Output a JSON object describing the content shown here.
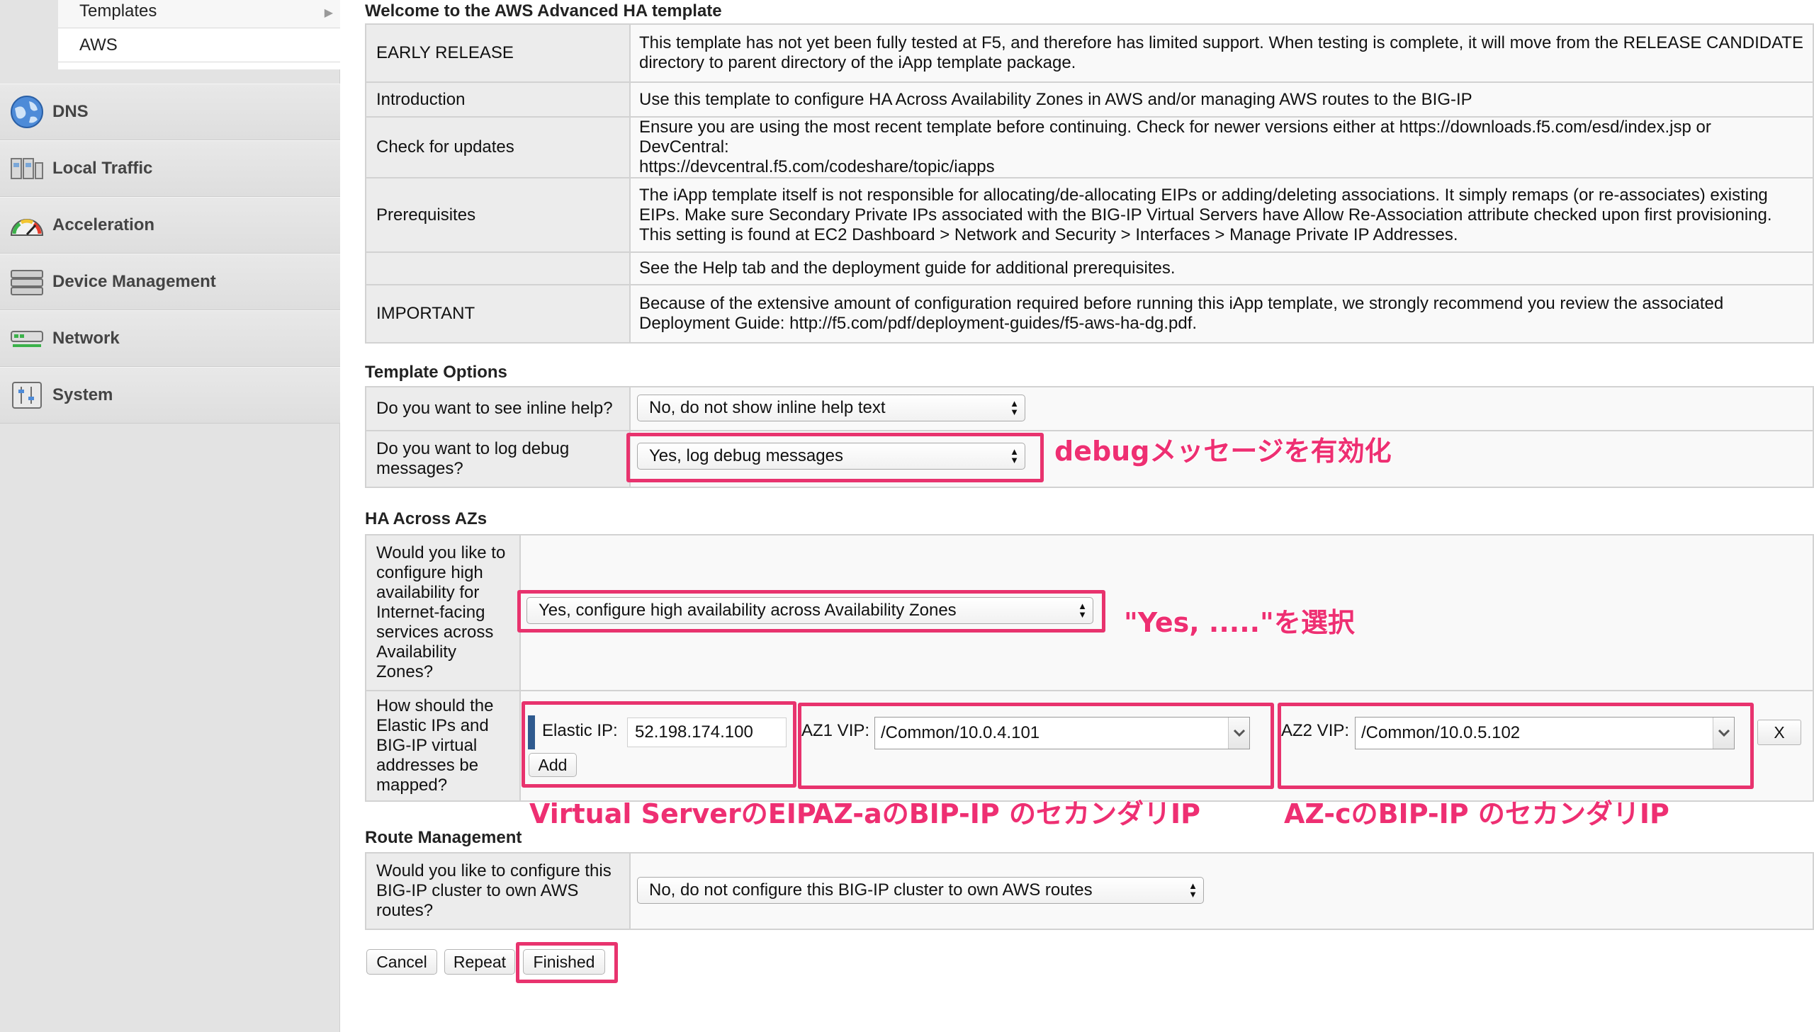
{
  "sidebar": {
    "submenu": [
      "Templates",
      "AWS"
    ],
    "items": [
      {
        "label": "DNS",
        "icon": "globe-icon"
      },
      {
        "label": "Local Traffic",
        "icon": "local-traffic-icon"
      },
      {
        "label": "Acceleration",
        "icon": "gauge-icon"
      },
      {
        "label": "Device Management",
        "icon": "device-icon"
      },
      {
        "label": "Network",
        "icon": "network-icon"
      },
      {
        "label": "System",
        "icon": "system-icon"
      }
    ]
  },
  "welcome": {
    "title": "Welcome to the AWS Advanced HA template",
    "rows": [
      {
        "label": "EARLY RELEASE",
        "value_lines": [
          "This template has not yet been fully tested at F5, and therefore has limited support. When testing is complete, it will move from the RELEASE CANDIDATE",
          "directory to parent directory of the iApp template package."
        ]
      },
      {
        "label": "Introduction",
        "value_lines": [
          "Use this template to configure HA Across Availability Zones in AWS and/or managing AWS routes to the BIG-IP"
        ]
      },
      {
        "label": "Check for updates",
        "value_lines": [
          "Ensure you are using the most recent template before continuing. Check for newer versions either at https://downloads.f5.com/esd/index.jsp or DevCentral:",
          "https://devcentral.f5.com/codeshare/topic/iapps"
        ]
      },
      {
        "label": "Prerequisites",
        "value_lines": [
          "The iApp template itself is not responsible for allocating/de-allocating EIPs or adding/deleting associations. It simply remaps (or re-associates) existing",
          "EIPs. Make sure Secondary Private IPs associated with the BIG-IP Virtual Servers have Allow Re-Association attribute checked upon first provisioning.",
          "This setting is found at EC2 Dashboard > Network and Security > Interfaces > Manage Private IP Addresses."
        ]
      },
      {
        "label": "",
        "value_lines": [
          "See the Help tab and the deployment guide for additional prerequisites."
        ]
      },
      {
        "label": "IMPORTANT",
        "value_lines": [
          "Because of the extensive amount of configuration required before running this iApp template, we strongly recommend you review the associated",
          "Deployment Guide: http://f5.com/pdf/deployment-guides/f5-aws-ha-dg.pdf."
        ]
      }
    ]
  },
  "template_options": {
    "title": "Template Options",
    "inline_help_label": "Do you want to see inline help?",
    "inline_help_value": "No, do not show inline help text",
    "debug_label_lines": [
      "Do you want to log debug",
      "messages?"
    ],
    "debug_value": "Yes, log debug messages"
  },
  "ha": {
    "title": "HA Across AZs",
    "configure_label_lines": [
      "Would you like to",
      "configure high",
      "availability for",
      "Internet-facing",
      "services across",
      "Availability",
      "Zones?"
    ],
    "configure_value": "Yes, configure high availability across Availability Zones",
    "mapping_label_lines": [
      "How should the",
      "Elastic IPs and",
      "BIG-IP virtual",
      "addresses be",
      "mapped?"
    ],
    "elastic_ip_label": "Elastic IP:",
    "elastic_ip_value": "52.198.174.100",
    "add_label": "Add",
    "az1_label": "AZ1 VIP:",
    "az1_value": "/Common/10.0.4.101",
    "az2_label": "AZ2 VIP:",
    "az2_value": "/Common/10.0.5.102",
    "remove_label": "X"
  },
  "route": {
    "title": "Route Management",
    "label_lines": [
      "Would you like to configure this",
      "BIG-IP cluster to own AWS",
      "routes?"
    ],
    "value": "No, do not configure this BIG-IP cluster to own AWS routes"
  },
  "buttons": {
    "cancel": "Cancel",
    "repeat": "Repeat",
    "finished": "Finished"
  },
  "annotations": {
    "debug": "debugメッセージを有効化",
    "yes": "\"Yes, .....\"を選択",
    "eip": "Virtual ServerのEIP",
    "az_a": "AZ-aのBIP-IP のセカンダリIP",
    "az_c": "AZ-cのBIP-IP のセカンダリIP"
  },
  "colors": {
    "annotation": "#e8336e",
    "sidebar_bg": "#e3e3e3"
  }
}
